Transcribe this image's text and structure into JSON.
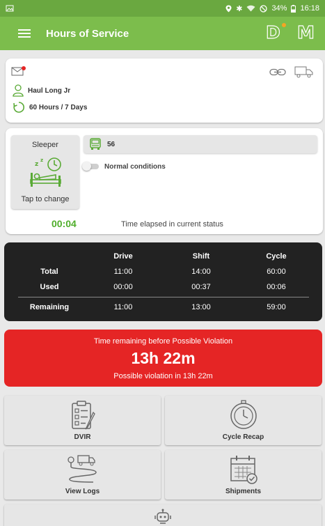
{
  "status_bar": {
    "left_icon": "image-icon",
    "battery": "34%",
    "time": "16:18"
  },
  "app_bar": {
    "menu_icon": "hamburger-icon",
    "title": "Hours of Service",
    "logo_d": "D",
    "logo_m": "M"
  },
  "driver": {
    "message_icon": "mail-icon",
    "name": "Haul Long Jr",
    "cycle_rule": "60 Hours / 7 Days",
    "connection_icon": "link-icon",
    "truck_icon": "truck-icon"
  },
  "current_status": {
    "status": "Sleeper",
    "tap_label": "Tap to change",
    "vehicle": "56",
    "conditions": "Normal conditions",
    "conditions_on": false,
    "elapsed": "00:04",
    "elapsed_label": "Time elapsed in current status"
  },
  "hours": {
    "headers": [
      "Drive",
      "Shift",
      "Cycle"
    ],
    "rows": [
      {
        "label": "Total",
        "values": [
          "11:00",
          "14:00",
          "60:00"
        ]
      },
      {
        "label": "Used",
        "values": [
          "00:00",
          "00:37",
          "00:06"
        ]
      },
      {
        "label": "Remaining",
        "values": [
          "11:00",
          "13:00",
          "59:00"
        ]
      }
    ]
  },
  "violation": {
    "title": "Time remaining before Possible Violation",
    "remaining": "13h 22m",
    "subtitle": "Possible violation in 13h 22m",
    "color": "#e52525"
  },
  "menu": [
    {
      "label": "DVIR",
      "icon": "clipboard-checklist-icon"
    },
    {
      "label": "Cycle Recap",
      "icon": "stopwatch-icon"
    },
    {
      "label": "View Logs",
      "icon": "route-icon"
    },
    {
      "label": "Shipments",
      "icon": "calendar-check-icon"
    },
    {
      "label": "",
      "icon": "robot-icon"
    }
  ],
  "colors": {
    "brand_green": "#7cbd4c",
    "status_bar_green": "#6aa840",
    "elapsed_green": "#4fae2b",
    "dark_panel": "#222222"
  }
}
